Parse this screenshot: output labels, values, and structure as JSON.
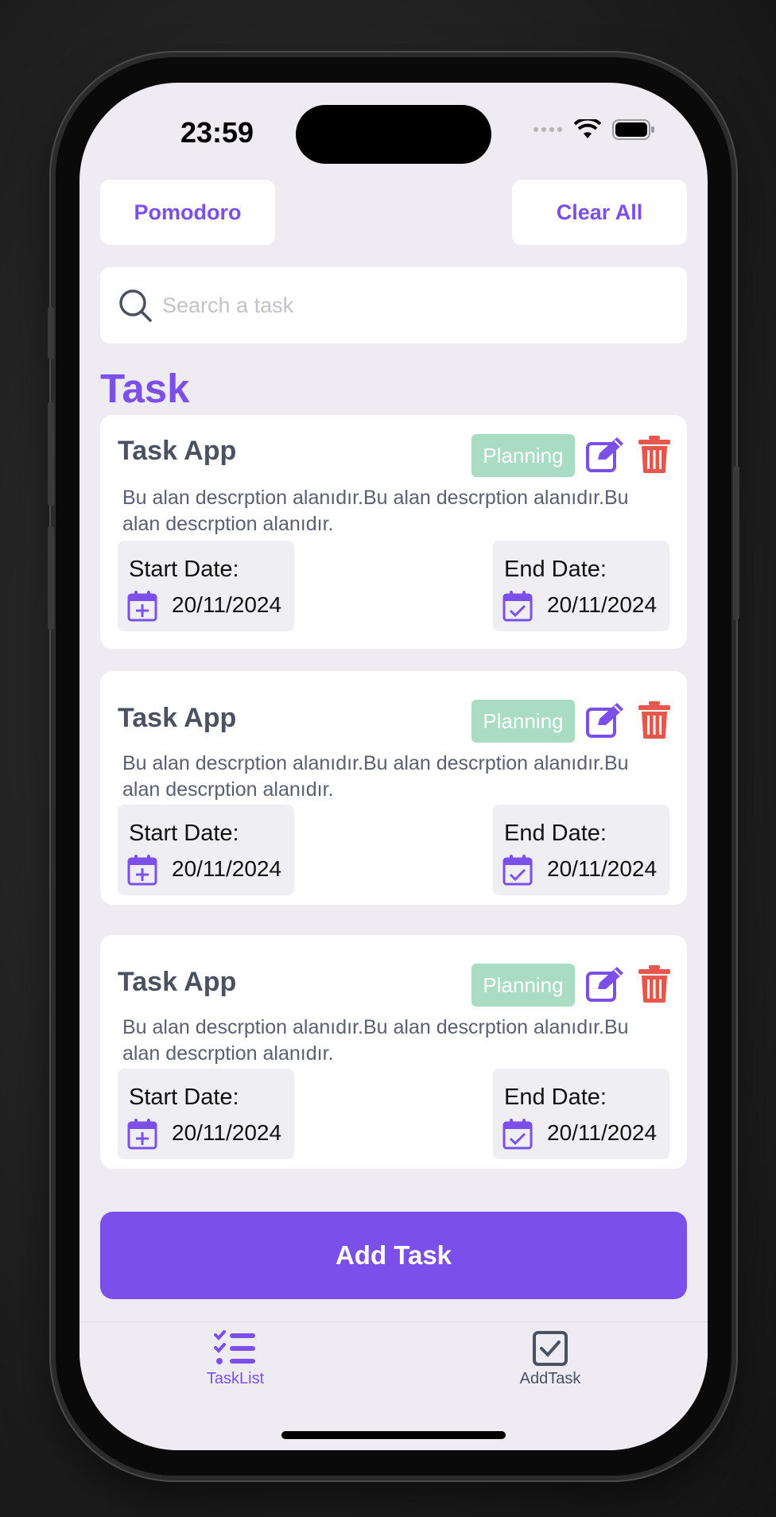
{
  "status_bar": {
    "time": "23:59"
  },
  "header": {
    "pomodoro_label": "Pomodoro",
    "clear_all_label": "Clear All"
  },
  "search": {
    "placeholder": "Search a task",
    "value": ""
  },
  "section": {
    "title": "Task"
  },
  "tasks": [
    {
      "title": "Task App",
      "status": "Planning",
      "description": "Bu alan descrption alanıdır.Bu alan descrption alanıdır.Bu alan descrption alanıdır.",
      "start_label": "Start Date:",
      "start_date": "20/11/2024",
      "end_label": "End Date:",
      "end_date": "20/11/2024"
    },
    {
      "title": "Task App",
      "status": "Planning",
      "description": "Bu alan descrption alanıdır.Bu alan descrption alanıdır.Bu alan descrption alanıdır.",
      "start_label": "Start Date:",
      "start_date": "20/11/2024",
      "end_label": "End Date:",
      "end_date": "20/11/2024"
    },
    {
      "title": "Task App",
      "status": "Planning",
      "description": "Bu alan descrption alanıdır.Bu alan descrption alanıdır.Bu alan descrption alanıdır.",
      "start_label": "Start Date:",
      "start_date": "20/11/2024",
      "end_label": "End Date:",
      "end_date": "20/11/2024"
    }
  ],
  "add_task": {
    "label": "Add Task"
  },
  "tabbar": {
    "items": [
      {
        "label": "TaskList",
        "icon": "task-list-icon",
        "active": true
      },
      {
        "label": "AddTask",
        "icon": "checkbox-icon",
        "active": false
      }
    ]
  },
  "colors": {
    "accent": "#7B4FEA",
    "badge": "#A9DCC2",
    "delete": "#E5564C",
    "background": "#EEEBF3"
  }
}
